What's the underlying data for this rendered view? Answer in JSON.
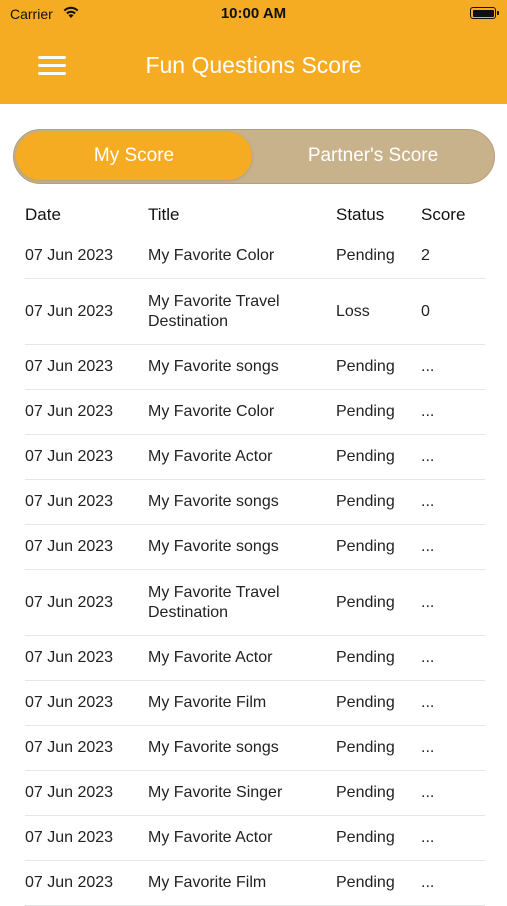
{
  "status_bar": {
    "carrier": "Carrier",
    "time": "10:00 AM"
  },
  "header": {
    "title": "Fun Questions Score"
  },
  "segment": {
    "my_score": "My Score",
    "partner_score": "Partner's Score",
    "selected": "My Score"
  },
  "table": {
    "columns": [
      "Date",
      "Title",
      "Status",
      "Score"
    ],
    "rows": [
      {
        "date": "07 Jun 2023",
        "title": "My Favorite Color",
        "status": "Pending",
        "score": "2"
      },
      {
        "date": "07 Jun 2023",
        "title": "My Favorite Travel Destination",
        "status": "Loss",
        "score": "0"
      },
      {
        "date": "07 Jun 2023",
        "title": "My Favorite songs",
        "status": "Pending",
        "score": "..."
      },
      {
        "date": "07 Jun 2023",
        "title": "My Favorite Color",
        "status": "Pending",
        "score": "..."
      },
      {
        "date": "07 Jun 2023",
        "title": "My Favorite Actor",
        "status": "Pending",
        "score": "..."
      },
      {
        "date": "07 Jun 2023",
        "title": "My Favorite songs",
        "status": "Pending",
        "score": "..."
      },
      {
        "date": "07 Jun 2023",
        "title": "My Favorite songs",
        "status": "Pending",
        "score": "..."
      },
      {
        "date": "07 Jun 2023",
        "title": "My Favorite Travel Destination",
        "status": "Pending",
        "score": "..."
      },
      {
        "date": "07 Jun 2023",
        "title": "My Favorite Actor",
        "status": "Pending",
        "score": "..."
      },
      {
        "date": "07 Jun 2023",
        "title": "My Favorite Film",
        "status": "Pending",
        "score": "..."
      },
      {
        "date": "07 Jun 2023",
        "title": "My Favorite songs",
        "status": "Pending",
        "score": "..."
      },
      {
        "date": "07 Jun 2023",
        "title": "My Favorite Singer",
        "status": "Pending",
        "score": "..."
      },
      {
        "date": "07 Jun 2023",
        "title": "My Favorite Actor",
        "status": "Pending",
        "score": "..."
      },
      {
        "date": "07 Jun 2023",
        "title": "My Favorite Film",
        "status": "Pending",
        "score": "..."
      }
    ]
  },
  "colors": {
    "accent": "#f5ac22",
    "segment_bg": "#c8b28c"
  },
  "icons": {
    "menu": "menu-icon",
    "wifi": "wifi-icon",
    "battery": "battery-icon"
  }
}
